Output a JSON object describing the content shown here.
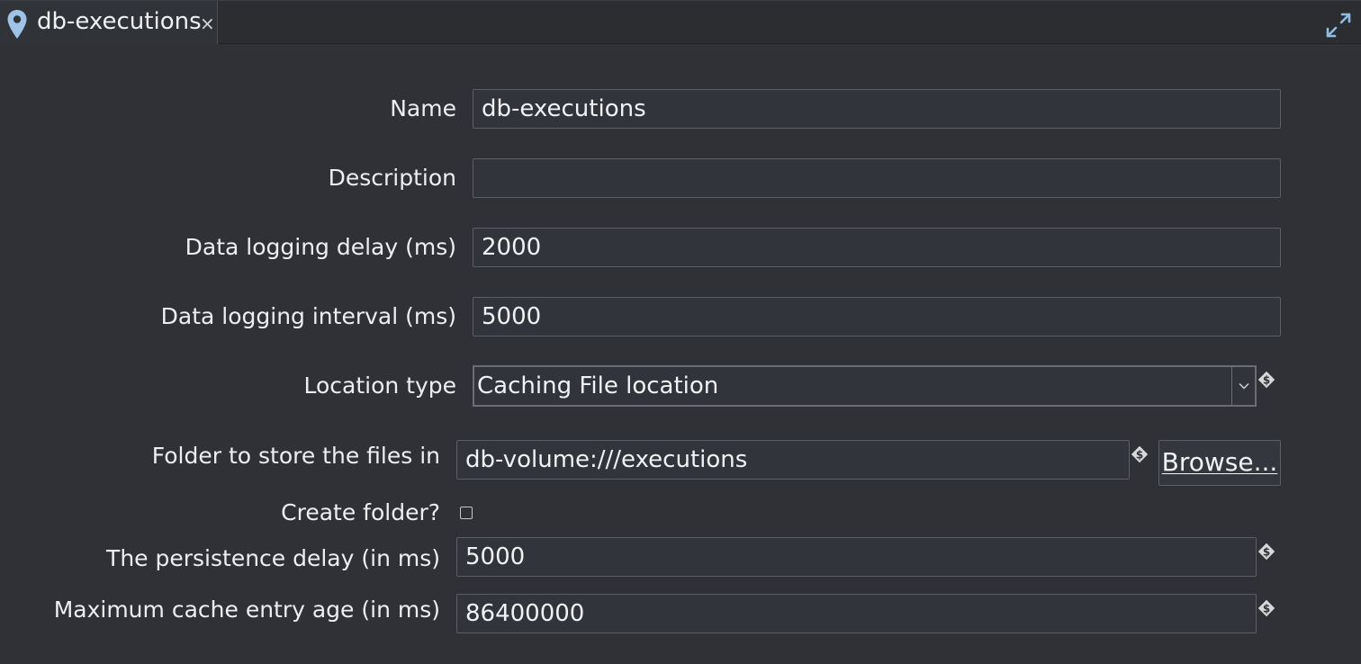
{
  "tab": {
    "title": "db-executions",
    "close": "×",
    "pin_icon": "map-pin-icon",
    "maximize_icon": "expand-icon"
  },
  "form": {
    "name": {
      "label": "Name",
      "value": "db-executions"
    },
    "description": {
      "label": "Description",
      "value": ""
    },
    "logging_delay": {
      "label": "Data logging delay (ms)",
      "value": "2000"
    },
    "logging_interval": {
      "label": "Data logging interval (ms)",
      "value": "5000"
    },
    "location_type": {
      "label": "Location type",
      "value": "Caching File location"
    },
    "folder": {
      "label": "Folder to store the files in",
      "value": "db-volume:///executions",
      "browse_label": "Browse..."
    },
    "create_folder": {
      "label": "Create folder?",
      "checked": false
    },
    "persistence_delay": {
      "label": "The persistence delay (in ms)",
      "value": "5000"
    },
    "max_cache_age": {
      "label": "Maximum cache entry age (in ms)",
      "value": "86400000"
    }
  },
  "colors": {
    "background": "#2f3136",
    "field_border": "#5b5e65",
    "pin": "#9fc3e6",
    "variable_icon": "#d6d8dc"
  }
}
